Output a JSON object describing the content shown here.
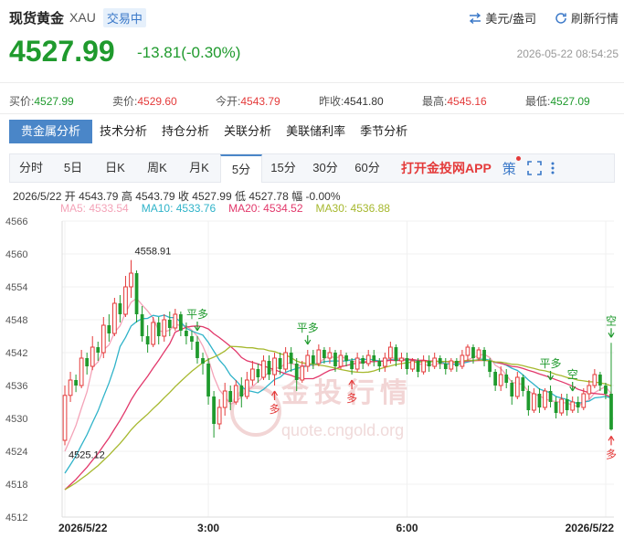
{
  "header": {
    "name": "现货黄金",
    "code": "XAU",
    "status": "交易中",
    "currency_label": "美元/盎司",
    "refresh_label": "刷新行情"
  },
  "price": {
    "last": "4527.99",
    "change": "-13.81(-0.30%)",
    "time": "2026-05-22 08:54:25"
  },
  "quotes": [
    {
      "label": "买价:",
      "value": "4527.99",
      "tone": "dn"
    },
    {
      "label": "卖价:",
      "value": "4529.60",
      "tone": "up"
    },
    {
      "label": "今开:",
      "value": "4543.79",
      "tone": "up"
    },
    {
      "label": "昨收:",
      "value": "4541.80",
      "tone": ""
    },
    {
      "label": "最高:",
      "value": "4545.16",
      "tone": "up"
    },
    {
      "label": "最低:",
      "value": "4527.09",
      "tone": "dn"
    }
  ],
  "analysis_tabs": [
    "贵金属分析",
    "技术分析",
    "持仓分析",
    "关联分析",
    "美联储利率",
    "季节分析"
  ],
  "period_tabs": [
    "分时",
    "5日",
    "日K",
    "周K",
    "月K",
    "5分",
    "15分",
    "30分",
    "60分"
  ],
  "active_period": "5分",
  "app_link": "打开金投网APP",
  "strategy_label": "策",
  "bar_info": {
    "date": "2026/5/22",
    "open_label": "开",
    "open": "4543.79",
    "high_label": "高",
    "high": "4543.79",
    "close_label": "收",
    "close": "4527.99",
    "low_label": "低",
    "low": "4527.78",
    "amp_label": "幅",
    "amp": "-0.00%"
  },
  "ma_legend": [
    {
      "text": "MA5: 4533.54",
      "color": "#f4a3b8"
    },
    {
      "text": "MA10: 4533.76",
      "color": "#2fb3c9"
    },
    {
      "text": "MA20: 4534.52",
      "color": "#e2386b"
    },
    {
      "text": "MA30: 4536.88",
      "color": "#a6b82e"
    }
  ],
  "colors": {
    "up": "#e43a3a",
    "down": "#1f9a2d",
    "accent": "#4a86c8"
  },
  "chart_data": {
    "type": "candlestick",
    "ylim": [
      4512,
      4566
    ],
    "yticks": [
      4566,
      4560,
      4554,
      4548,
      4542,
      4536,
      4530,
      4524,
      4518,
      4512
    ],
    "xticks": [
      {
        "label": "2026/5/22",
        "index": 0
      },
      {
        "label": "3:00",
        "index": 26
      },
      {
        "label": "6:00",
        "index": 62
      },
      {
        "label": "2026/5/22",
        "index": 98
      }
    ],
    "annotations": {
      "max_label": "4558.91",
      "min_label": "4525.12",
      "signals": [
        {
          "text": "平多",
          "index": 24,
          "dir": "down"
        },
        {
          "text": "多",
          "index": 38,
          "dir": "up"
        },
        {
          "text": "平多",
          "index": 44,
          "dir": "down"
        },
        {
          "text": "多",
          "index": 52,
          "dir": "up"
        },
        {
          "text": "平多",
          "index": 88,
          "dir": "down"
        },
        {
          "text": "空",
          "index": 92,
          "dir": "down"
        },
        {
          "text": "多",
          "index": 104,
          "dir": "up"
        },
        {
          "text": "空",
          "index": 107,
          "dir": "down"
        }
      ]
    },
    "watermark": {
      "title": "金投行情",
      "url": "quote.cngold.org"
    },
    "candles": [
      [
        4526.0,
        4534.2,
        4525.1,
        4536.0
      ],
      [
        4534.2,
        4537.0,
        4533.0,
        4538.5
      ],
      [
        4537.0,
        4536.0,
        4534.8,
        4538.0
      ],
      [
        4536.0,
        4541.0,
        4535.5,
        4542.5
      ],
      [
        4541.0,
        4539.5,
        4538.0,
        4542.0
      ],
      [
        4539.5,
        4543.0,
        4538.8,
        4545.0
      ],
      [
        4543.0,
        4542.0,
        4540.5,
        4544.0
      ],
      [
        4542.0,
        4547.0,
        4541.0,
        4548.5
      ],
      [
        4547.0,
        4545.5,
        4544.0,
        4549.0
      ],
      [
        4545.5,
        4551.0,
        4545.0,
        4552.0
      ],
      [
        4551.0,
        4549.0,
        4547.5,
        4552.5
      ],
      [
        4549.0,
        4554.0,
        4548.5,
        4556.0
      ],
      [
        4554.0,
        4556.5,
        4552.0,
        4558.9
      ],
      [
        4556.5,
        4549.0,
        4547.5,
        4557.0
      ],
      [
        4549.0,
        4545.0,
        4544.0,
        4550.5
      ],
      [
        4545.0,
        4543.5,
        4542.0,
        4547.0
      ],
      [
        4543.5,
        4547.5,
        4543.0,
        4548.5
      ],
      [
        4547.5,
        4545.0,
        4543.5,
        4548.5
      ],
      [
        4545.0,
        4548.0,
        4544.0,
        4549.0
      ],
      [
        4548.0,
        4546.5,
        4545.0,
        4549.5
      ],
      [
        4546.5,
        4549.0,
        4546.0,
        4550.0
      ],
      [
        4549.0,
        4546.0,
        4545.0,
        4549.5
      ],
      [
        4546.0,
        4545.0,
        4543.5,
        4547.5
      ],
      [
        4545.0,
        4544.0,
        4542.5,
        4546.0
      ],
      [
        4544.0,
        4541.0,
        4540.0,
        4545.0
      ],
      [
        4541.0,
        4540.0,
        4538.0,
        4542.0
      ],
      [
        4540.0,
        4534.0,
        4532.5,
        4541.0
      ],
      [
        4534.0,
        4529.0,
        4526.5,
        4535.0
      ],
      [
        4529.0,
        4532.0,
        4528.0,
        4533.5
      ],
      [
        4532.0,
        4535.0,
        4530.5,
        4536.5
      ],
      [
        4535.0,
        4533.0,
        4531.5,
        4536.0
      ],
      [
        4533.0,
        4536.0,
        4532.5,
        4537.0
      ],
      [
        4536.0,
        4534.0,
        4532.0,
        4537.5
      ],
      [
        4534.0,
        4537.0,
        4533.5,
        4538.5
      ],
      [
        4537.0,
        4539.0,
        4536.0,
        4540.5
      ],
      [
        4539.0,
        4537.5,
        4536.5,
        4540.0
      ],
      [
        4537.5,
        4540.5,
        4537.0,
        4541.5
      ],
      [
        4540.5,
        4538.0,
        4537.0,
        4541.5
      ],
      [
        4538.0,
        4541.0,
        4536.0,
        4542.0
      ],
      [
        4541.0,
        4539.0,
        4538.0,
        4542.0
      ],
      [
        4539.0,
        4542.0,
        4538.5,
        4543.0
      ],
      [
        4542.0,
        4540.0,
        4538.5,
        4543.0
      ],
      [
        4540.0,
        4537.0,
        4535.0,
        4541.0
      ],
      [
        4537.0,
        4539.5,
        4536.5,
        4540.5
      ],
      [
        4539.5,
        4541.5,
        4538.5,
        4542.5
      ],
      [
        4541.5,
        4540.0,
        4539.0,
        4542.5
      ],
      [
        4540.0,
        4542.5,
        4539.5,
        4543.5
      ],
      [
        4542.5,
        4541.0,
        4540.0,
        4543.0
      ],
      [
        4541.0,
        4542.0,
        4540.0,
        4543.0
      ],
      [
        4542.0,
        4539.5,
        4538.5,
        4542.5
      ],
      [
        4539.5,
        4541.5,
        4539.0,
        4542.5
      ],
      [
        4541.5,
        4540.5,
        4539.5,
        4542.0
      ],
      [
        4540.5,
        4539.0,
        4538.0,
        4541.0
      ],
      [
        4539.0,
        4541.0,
        4538.5,
        4542.0
      ],
      [
        4541.0,
        4540.0,
        4539.0,
        4541.5
      ],
      [
        4540.0,
        4541.5,
        4539.5,
        4542.5
      ],
      [
        4541.5,
        4540.5,
        4539.5,
        4542.5
      ],
      [
        4540.5,
        4539.5,
        4538.5,
        4541.0
      ],
      [
        4539.5,
        4541.0,
        4538.5,
        4542.0
      ],
      [
        4541.0,
        4543.0,
        4540.0,
        4544.0
      ],
      [
        4543.0,
        4540.5,
        4539.5,
        4543.5
      ],
      [
        4540.5,
        4541.0,
        4539.0,
        4542.0
      ],
      [
        4541.0,
        4539.0,
        4538.0,
        4542.0
      ],
      [
        4539.0,
        4540.5,
        4538.5,
        4541.0
      ],
      [
        4540.5,
        4538.5,
        4537.5,
        4541.0
      ],
      [
        4538.5,
        4540.5,
        4538.0,
        4541.5
      ],
      [
        4540.5,
        4539.5,
        4538.5,
        4541.5
      ],
      [
        4539.5,
        4541.0,
        4539.0,
        4542.0
      ],
      [
        4541.0,
        4540.0,
        4539.0,
        4541.5
      ],
      [
        4540.0,
        4539.0,
        4538.0,
        4541.0
      ],
      [
        4539.0,
        4540.5,
        4538.5,
        4541.0
      ],
      [
        4540.5,
        4539.5,
        4538.5,
        4541.0
      ],
      [
        4539.5,
        4541.5,
        4539.0,
        4542.5
      ],
      [
        4541.5,
        4543.0,
        4540.5,
        4543.5
      ],
      [
        4543.0,
        4541.0,
        4540.0,
        4543.5
      ],
      [
        4541.0,
        4542.5,
        4540.5,
        4543.0
      ],
      [
        4542.5,
        4540.5,
        4539.5,
        4543.0
      ],
      [
        4540.5,
        4538.5,
        4537.5,
        4541.0
      ],
      [
        4538.5,
        4536.0,
        4535.0,
        4539.0
      ],
      [
        4536.0,
        4538.0,
        4535.0,
        4539.5
      ],
      [
        4538.0,
        4536.5,
        4535.5,
        4539.0
      ],
      [
        4536.5,
        4534.0,
        4532.5,
        4537.0
      ],
      [
        4534.0,
        4537.5,
        4533.5,
        4538.5
      ],
      [
        4537.5,
        4535.0,
        4534.0,
        4538.0
      ],
      [
        4535.0,
        4531.5,
        4530.5,
        4536.0
      ],
      [
        4531.5,
        4534.5,
        4531.0,
        4535.5
      ],
      [
        4534.5,
        4532.0,
        4531.0,
        4535.5
      ],
      [
        4532.0,
        4535.0,
        4531.5,
        4535.5
      ],
      [
        4535.0,
        4533.0,
        4532.0,
        4536.0
      ],
      [
        4533.0,
        4531.0,
        4530.0,
        4534.0
      ],
      [
        4531.0,
        4533.5,
        4530.5,
        4534.5
      ],
      [
        4533.5,
        4531.5,
        4530.5,
        4534.5
      ],
      [
        4531.5,
        4533.0,
        4531.0,
        4534.0
      ],
      [
        4533.0,
        4532.0,
        4531.0,
        4534.0
      ],
      [
        4532.0,
        4534.5,
        4531.5,
        4535.5
      ],
      [
        4534.5,
        4536.0,
        4533.5,
        4537.0
      ],
      [
        4536.0,
        4538.0,
        4535.5,
        4539.0
      ],
      [
        4538.0,
        4536.0,
        4535.0,
        4538.5
      ],
      [
        4536.0,
        4534.5,
        4533.5,
        4536.5
      ],
      [
        4534.5,
        4527.99,
        4527.78,
        4543.79
      ]
    ]
  }
}
